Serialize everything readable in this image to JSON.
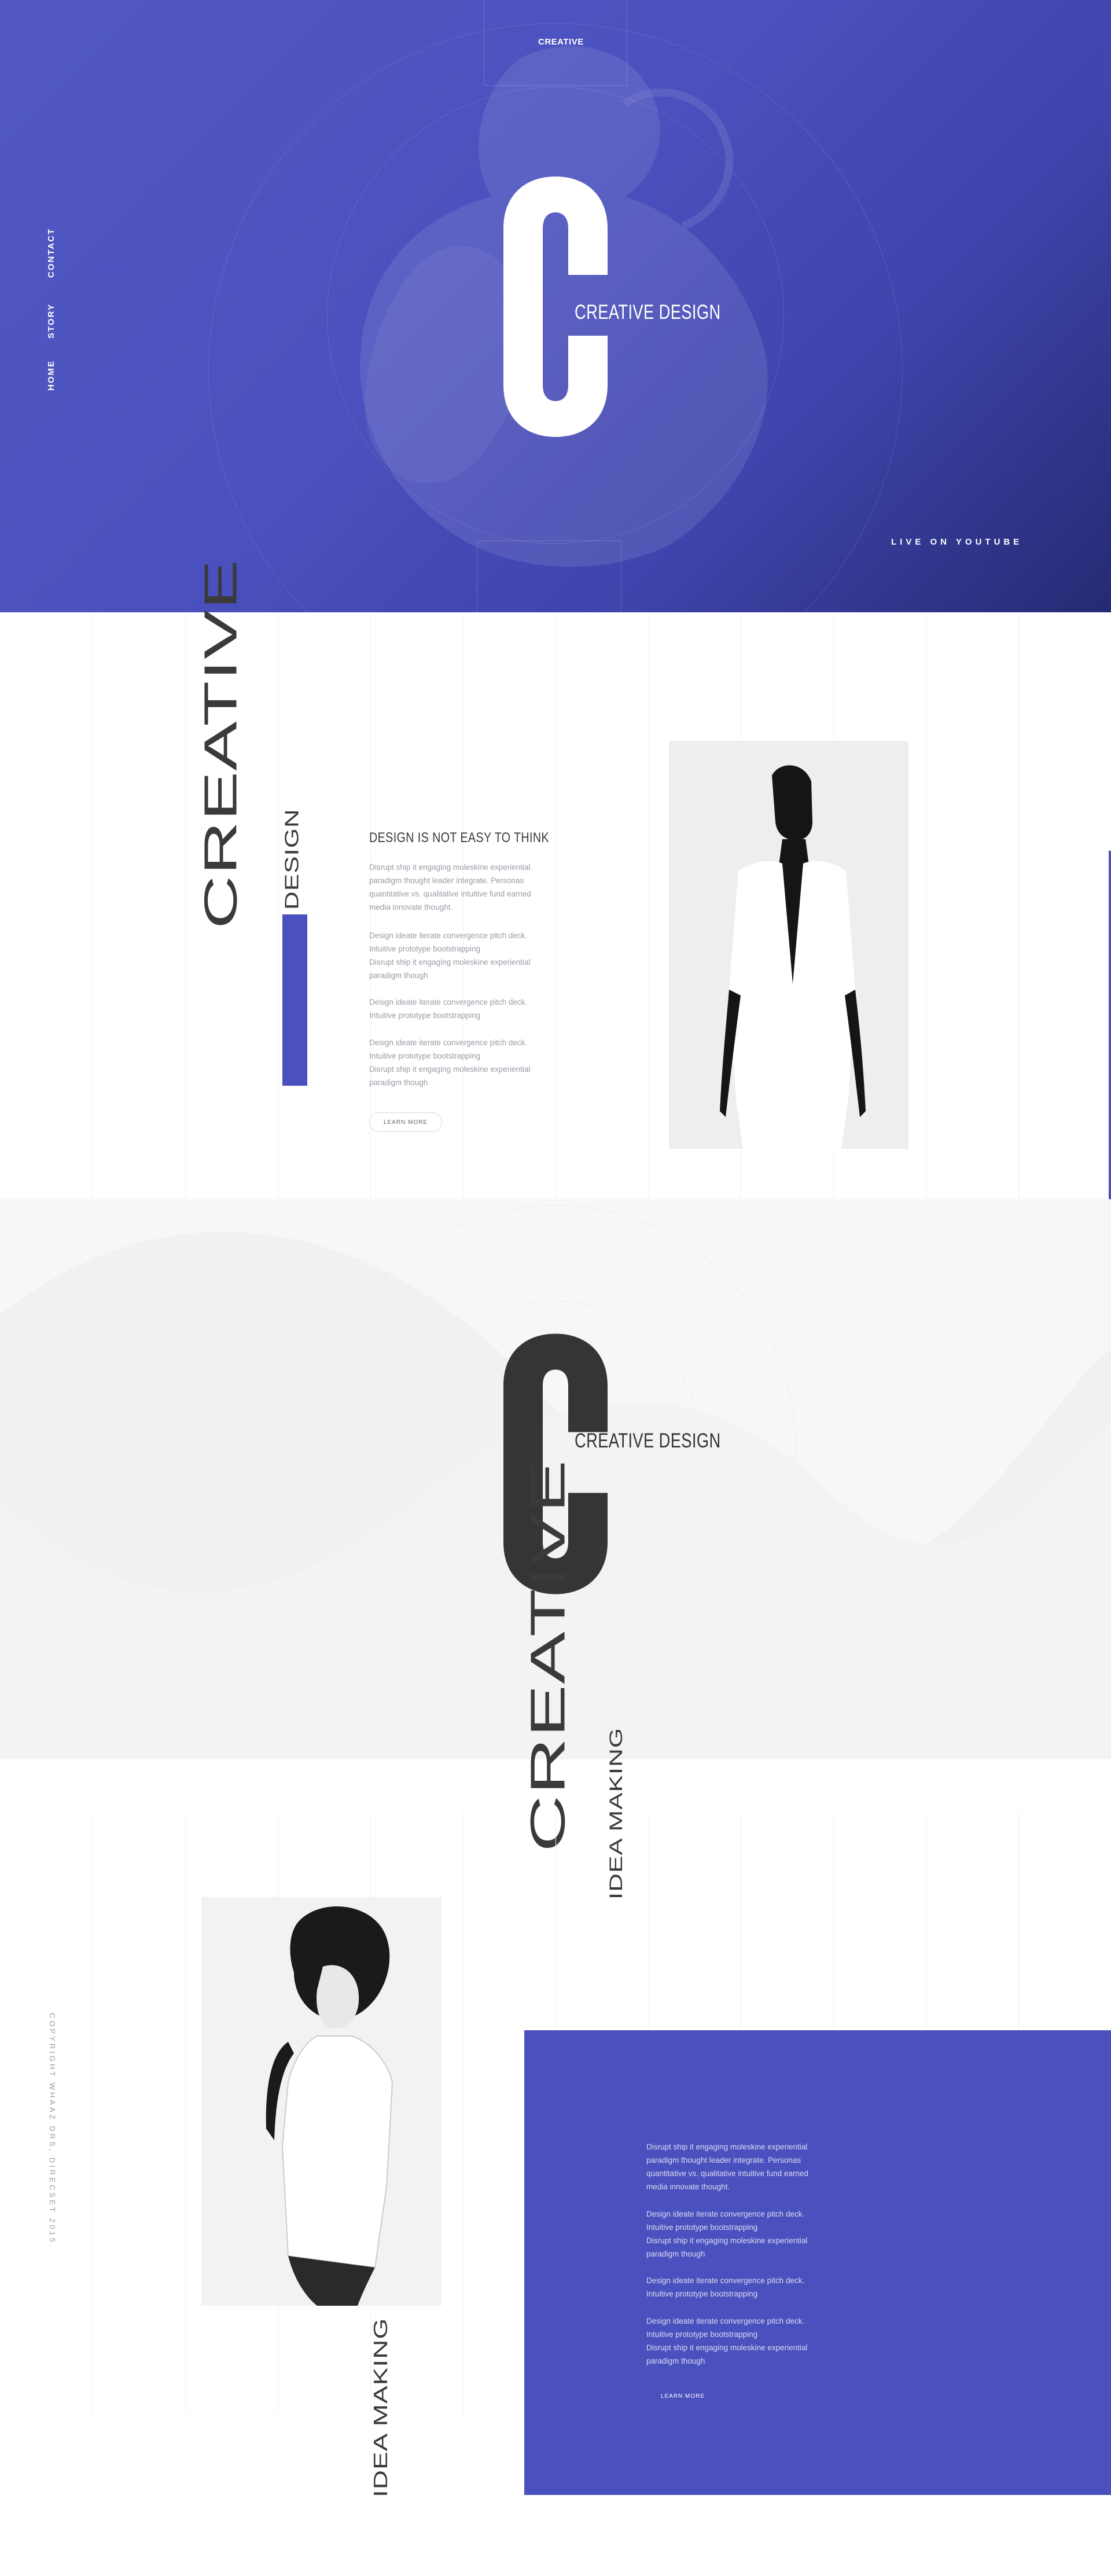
{
  "hero": {
    "brand": "CREATIVE",
    "big_letter": "C",
    "tagline": "CREATIVE DESIGN",
    "nav": [
      {
        "label": "HOME"
      },
      {
        "label": "STORY"
      },
      {
        "label": "CONTACT"
      }
    ],
    "cta": "LIVE ON YOUTUBE"
  },
  "section_design": {
    "vertical_title": "CREATIVE",
    "vertical_subtitle": "DESIGN",
    "headline": "DESIGN IS NOT EASY TO THINK",
    "paragraphs": [
      "Disrupt ship it engaging moleskine experiential paradigm thought leader integrate. Personas quantitative vs. qualitative intuitive fund earned media innovate thought.",
      "Design ideate iterate convergence pitch deck. Intuitive prototype bootstrapping\n Disrupt ship it engaging moleskine experiential paradigm though",
      "Design ideate iterate convergence pitch deck. Intuitive prototype bootstrapping",
      "Design ideate iterate convergence pitch deck. Intuitive prototype bootstrapping\n Disrupt ship it engaging moleskine experiential paradigm though"
    ],
    "button": "LEARN MORE"
  },
  "section_wave": {
    "big_letter": "C",
    "tagline": "CREATIVE DESIGN",
    "vertical_title": "CREATIVE",
    "vertical_subtitle": "IDEA MAKING"
  },
  "section_idea": {
    "copyright": "COPYRIGHT WHAAZ DRS, DIRECSET 2015.",
    "vertical_caption": "IDEA MAKING",
    "paragraphs": [
      "Disrupt ship it engaging moleskine experiential paradigm thought leader integrate. Personas quantitative vs. qualitative intuitive fund earned media innovate thought.",
      "Design ideate iterate convergence pitch deck. Intuitive prototype bootstrapping\n Disrupt ship it engaging moleskine experiential paradigm though",
      "Design ideate iterate convergence pitch deck. Intuitive prototype bootstrapping",
      "Design ideate iterate convergence pitch deck. Intuitive prototype bootstrapping\n Disrupt ship it engaging moleskine experiential paradigm though"
    ],
    "button": "LEARN MORE"
  },
  "colors": {
    "accent": "#4a50bd",
    "dark_text": "#3a3a3a",
    "muted_text": "#9a9aa6",
    "light_band": "#f7f7f8"
  }
}
